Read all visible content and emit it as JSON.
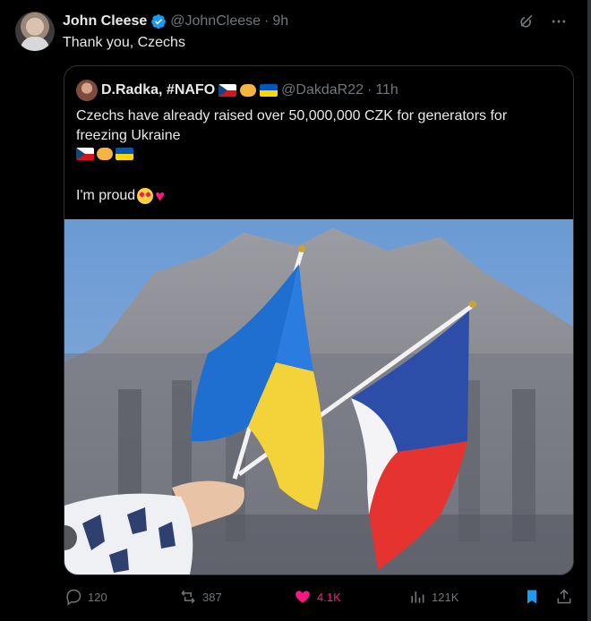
{
  "tweet": {
    "author_name": "John Cleese",
    "author_handle": "@JohnCleese",
    "time": "9h",
    "text": "Thank you, Czechs"
  },
  "quoted": {
    "author_name": "D.Radka, #NAFO",
    "author_handle": "@DakdaR22",
    "time": "11h",
    "text": "Czechs have already raised over 50,000,000 CZK for generators for freezing Ukraine",
    "proud_text": "I'm proud",
    "image_subject": "Ukrainian and Czech flags held in front of a building"
  },
  "actions": {
    "replies": "120",
    "reposts": "387",
    "likes": "4.1K",
    "views": "121K"
  },
  "icons": {
    "verified": "verified-badge-icon",
    "grok": "grok-icon",
    "more": "more-icon",
    "reply": "reply-icon",
    "repost": "repost-icon",
    "like": "heart-icon",
    "views": "views-icon",
    "bookmark": "bookmark-icon",
    "share": "share-icon"
  },
  "colors": {
    "background": "#000000",
    "text": "#e7e9ea",
    "muted": "#71767b",
    "border": "#2f3336",
    "verified": "#1d9bf0",
    "like": "#f91880",
    "bookmark": "#1d9bf0"
  }
}
